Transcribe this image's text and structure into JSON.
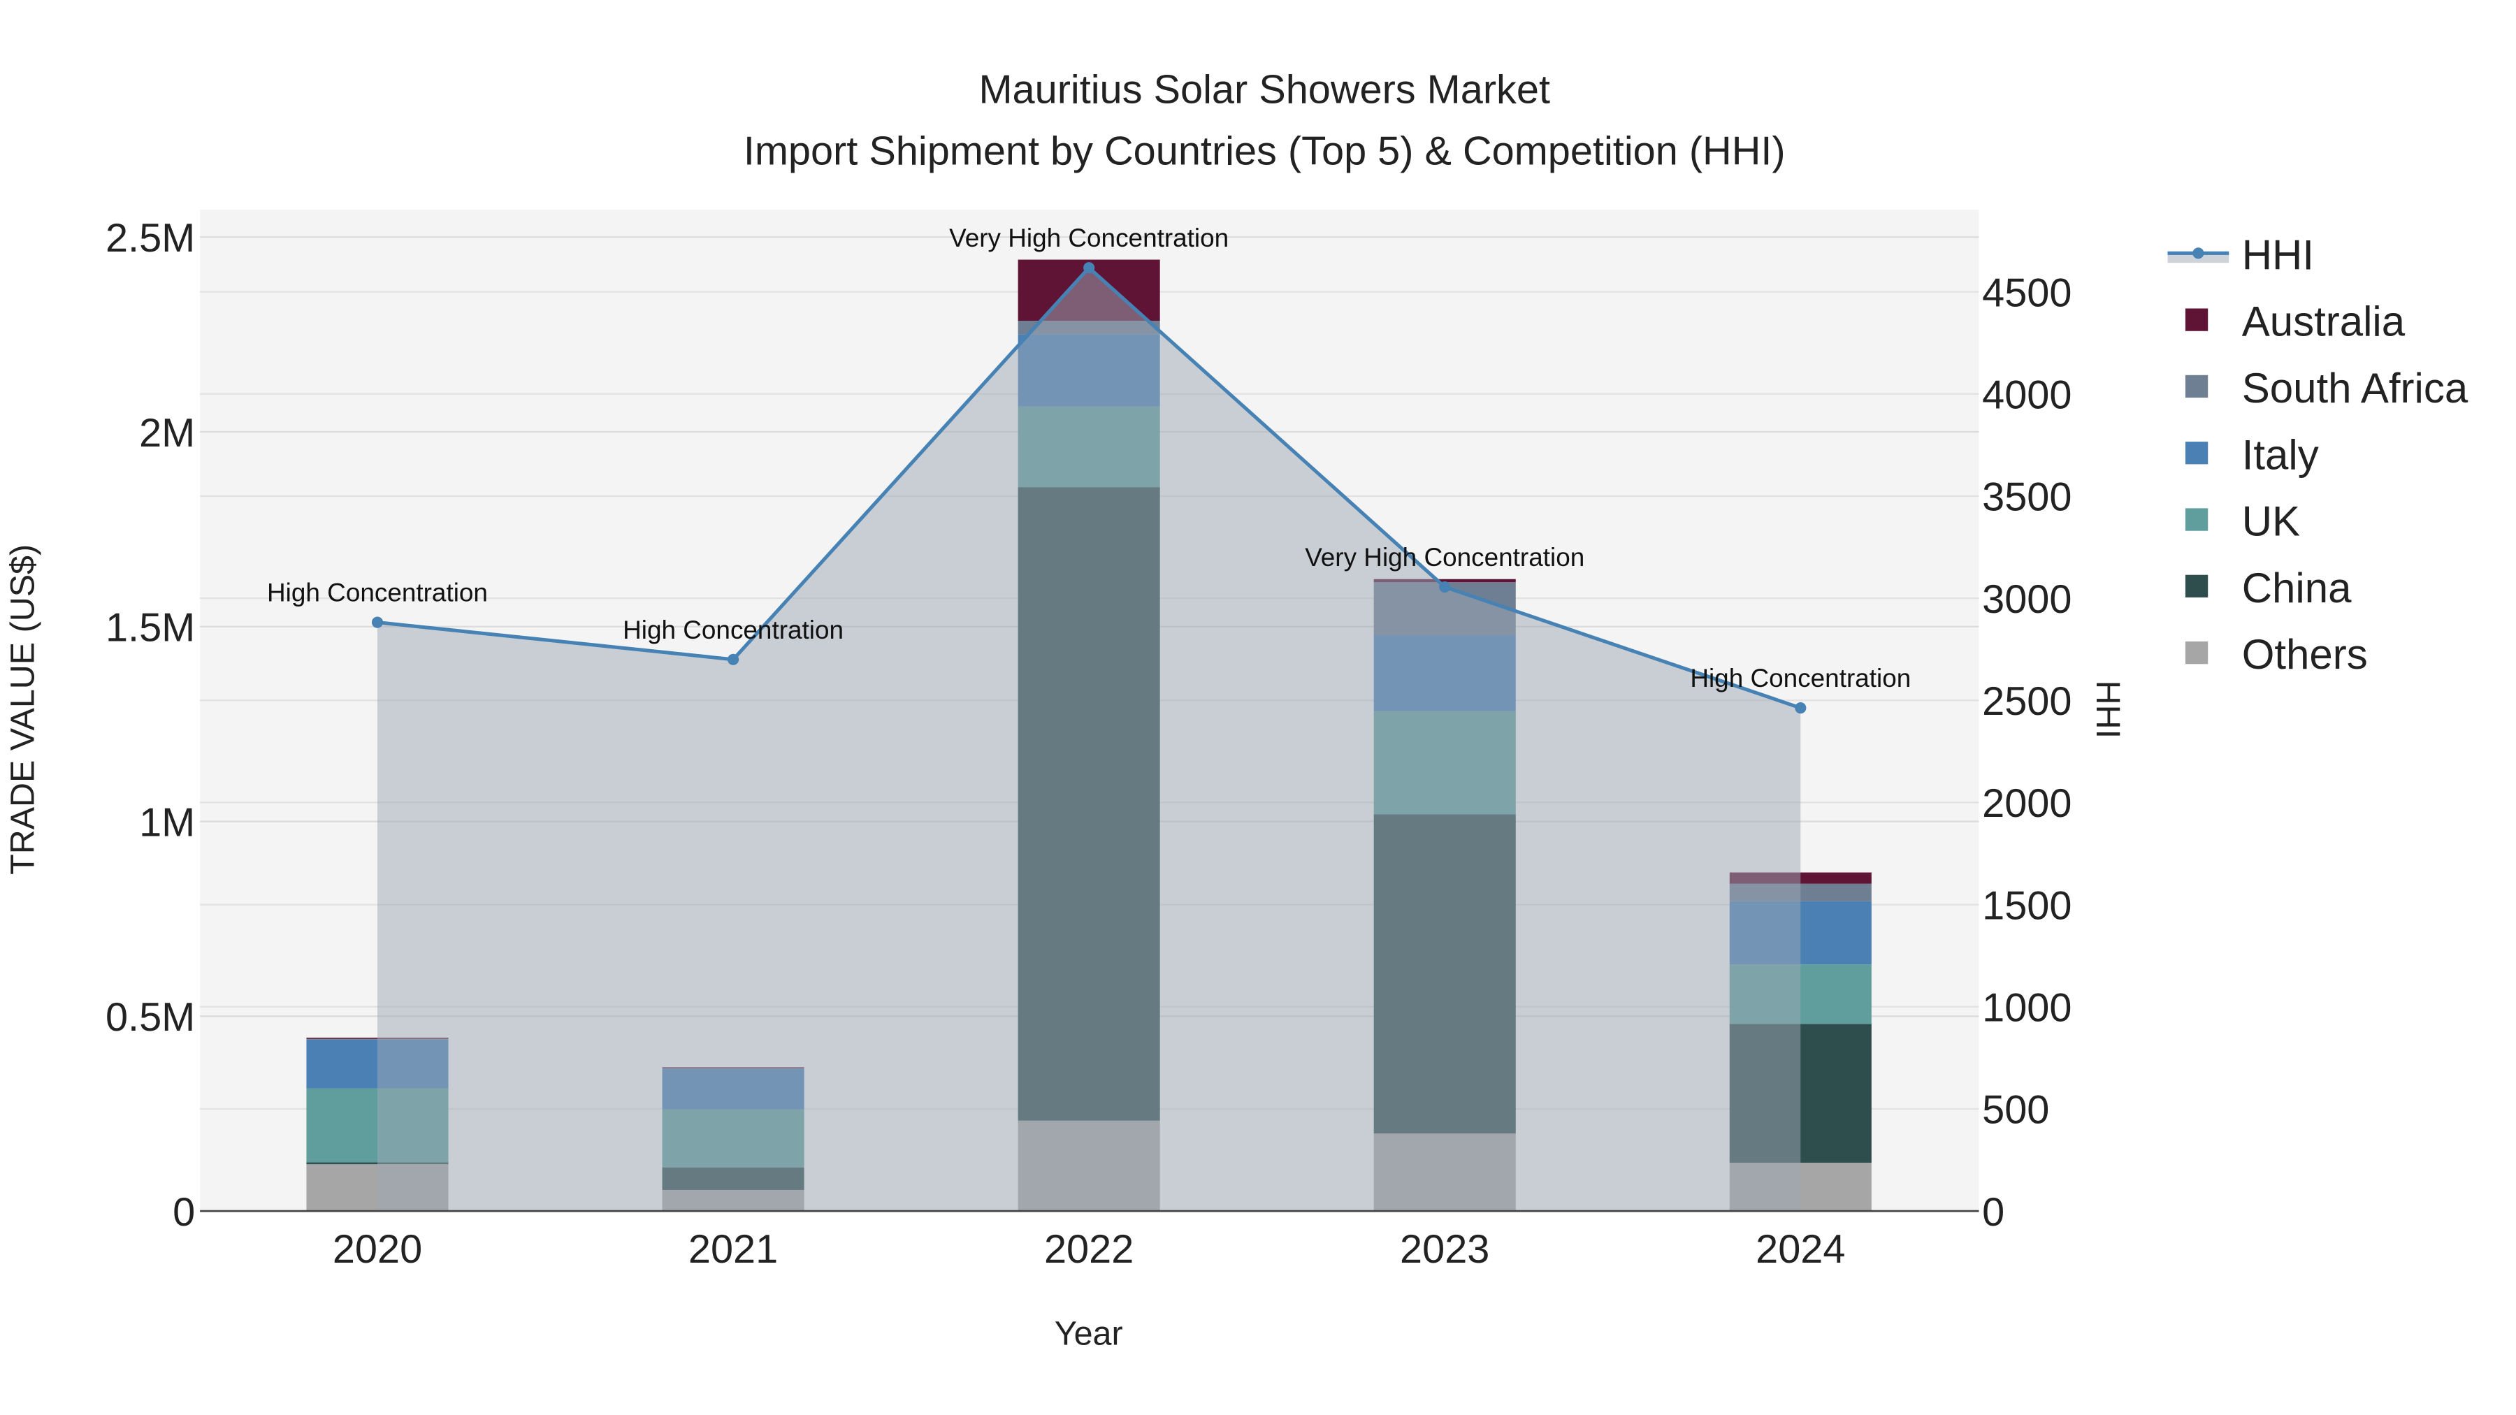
{
  "chart_data": {
    "type": "bar",
    "title": "Mauritius Solar Showers Market",
    "subtitle": "Import Shipment by Countries (Top 5) & Competition (HHI)",
    "xlabel": "Year",
    "ylabel": "TRADE VALUE (US$)",
    "y2label": "HHI",
    "categories": [
      "2020",
      "2021",
      "2022",
      "2023",
      "2024"
    ],
    "ylim": [
      0,
      2500000
    ],
    "y2lim": [
      0,
      4800
    ],
    "yticks": [
      {
        "v": 0,
        "label": "0"
      },
      {
        "v": 500000,
        "label": "0.5M"
      },
      {
        "v": 1000000,
        "label": "1M"
      },
      {
        "v": 1500000,
        "label": "1.5M"
      },
      {
        "v": 2000000,
        "label": "2M"
      },
      {
        "v": 2500000,
        "label": "2.5M"
      }
    ],
    "y2ticks": [
      {
        "v": 0,
        "label": "0"
      },
      {
        "v": 500,
        "label": "500"
      },
      {
        "v": 1000,
        "label": "1000"
      },
      {
        "v": 1500,
        "label": "1500"
      },
      {
        "v": 2000,
        "label": "2000"
      },
      {
        "v": 2500,
        "label": "2500"
      },
      {
        "v": 3000,
        "label": "3000"
      },
      {
        "v": 3500,
        "label": "3500"
      },
      {
        "v": 4000,
        "label": "4000"
      },
      {
        "v": 4500,
        "label": "4500"
      }
    ],
    "series": [
      {
        "name": "Others",
        "color": "#a6a6a6",
        "values": [
          120000,
          54000,
          232000,
          199000,
          124000
        ]
      },
      {
        "name": "China",
        "color": "#2e4d4d",
        "values": [
          5000,
          58000,
          1626000,
          819000,
          356000
        ]
      },
      {
        "name": "UK",
        "color": "#5f9e9c",
        "values": [
          190000,
          149000,
          207000,
          265000,
          153000
        ]
      },
      {
        "name": "Italy",
        "color": "#4a80b4",
        "values": [
          125000,
          104000,
          185000,
          195000,
          162000
        ]
      },
      {
        "name": "South Africa",
        "color": "#6f7f93",
        "values": [
          2000,
          2000,
          35000,
          136000,
          45000
        ]
      },
      {
        "name": "Australia",
        "color": "#5f1435",
        "values": [
          3000,
          2000,
          157000,
          8000,
          29000
        ]
      }
    ],
    "hhi": {
      "name": "HHI",
      "color": "#4682b4",
      "values": [
        2882,
        2700,
        4618,
        3055,
        2463
      ],
      "annotations": [
        "High Concentration",
        "High Concentration",
        "Very High Concentration",
        "Very High Concentration",
        "High Concentration"
      ]
    },
    "legend_order": [
      "HHI",
      "Australia",
      "South Africa",
      "Italy",
      "UK",
      "China",
      "Others"
    ],
    "legend_position": "right",
    "grid": true
  }
}
